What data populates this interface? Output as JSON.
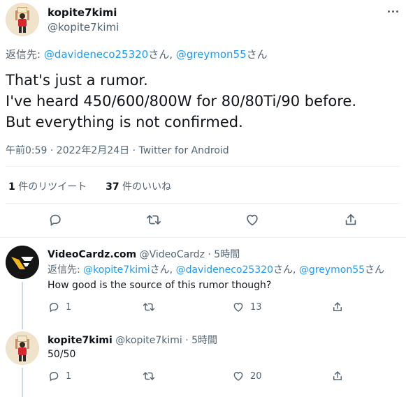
{
  "main_tweet": {
    "display_name": "kopite7kimi",
    "handle": "@kopite7kimi",
    "reply_prefix": "返信先: ",
    "reply_to_1": "@davideneco25320",
    "reply_suffix_1": "さん, ",
    "reply_to_2": "@greymon55",
    "reply_suffix_2": "さん",
    "text_line1": "That's just a rumor.",
    "text_line2": "I've heard 450/600/800W for 80/80Ti/90 before.",
    "text_line3": "But everything is not confirmed.",
    "meta": "午前0:59 · 2022年2月24日 · Twitter for Android",
    "retweet_count": "1",
    "retweet_label": " 件のリツイート",
    "like_count": "37",
    "like_label": " 件のいいね"
  },
  "replies": [
    {
      "display_name": "VideoCardz.com",
      "handle_time": "@VideoCardz · 5時間",
      "reply_prefix": "返信先: ",
      "reply_to_1": "@kopite7kimi",
      "reply_suffix_1": "さん, ",
      "reply_to_2": "@davideneco25320",
      "reply_suffix_2": "さん, ",
      "reply_to_3": "@greymon55",
      "reply_suffix_3": "さん",
      "text": "How good is the source of this rumor though?",
      "reply_count": "1",
      "retweet_count": "",
      "like_count": "13"
    },
    {
      "display_name": "kopite7kimi",
      "handle_time": "@kopite7kimi · 5時間",
      "text": "50/50",
      "reply_count": "1",
      "retweet_count": "",
      "like_count": "20"
    }
  ],
  "icons": {
    "reply": "speech-bubble-icon",
    "retweet": "retweet-icon",
    "like": "heart-icon",
    "share": "share-icon",
    "more": "more-dots-icon"
  },
  "colors": {
    "link": "#1d9bf0",
    "muted": "#536471",
    "text": "#0f1419",
    "divider": "#eff3f4"
  }
}
